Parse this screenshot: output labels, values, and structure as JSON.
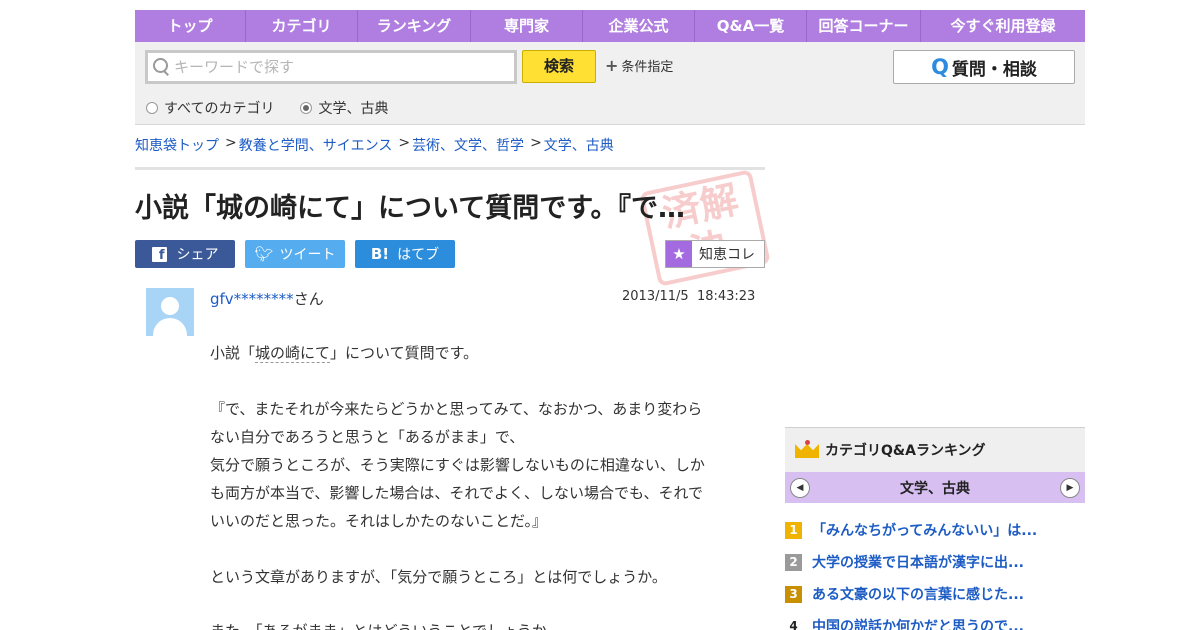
{
  "nav": {
    "items": [
      {
        "label": "トップ",
        "w": 111
      },
      {
        "label": "カテゴリ",
        "w": 112
      },
      {
        "label": "ランキング",
        "w": 113
      },
      {
        "label": "専門家",
        "w": 112
      },
      {
        "label": "企業公式",
        "w": 112
      },
      {
        "label": "Q&A一覧",
        "w": 112
      },
      {
        "label": "回答コーナー",
        "w": 114
      },
      {
        "label": "今すぐ利用登録",
        "w": 164
      }
    ]
  },
  "search": {
    "placeholder": "キーワードで探す",
    "button_label": "検索",
    "conditions_label": "条件指定",
    "ask_button_label": "質問・相談",
    "radio_all": "すべてのカテゴリ",
    "radio_current": "文学、古典"
  },
  "breadcrumb": {
    "items": [
      "知恵袋トップ",
      "教養と学問、サイエンス",
      "芸術、文学、哲学",
      "文学、古典"
    ],
    "separator": ">"
  },
  "question": {
    "title": "小説「城の崎にて」について質問です。『で…",
    "stamp": "済解決",
    "user_name": "gfv********",
    "user_suffix": "さん",
    "date": "2013/11/5",
    "time": "18:43:23",
    "line1_pre": "小説「",
    "line1_kw": "城の崎にて",
    "line1_post": "」について質問です。",
    "lines": [
      "『で、またそれが今来たらどうかと思ってみて、なおかつ、あまり変わら",
      "ない自分であろうと思うと「あるがまま」で、",
      "気分で願うところが、そう実際にすぐは影響しないものに相違ない、しか",
      "も両方が本当で、影響した場合は、それでよく、しない場合でも、それで",
      "いいのだと思った。それはしかたのないことだ。』",
      "という文章がありますが、「気分で願うところ」とは何でしょうか。",
      "また、「あるがまま」とはどういうことでしょうか。"
    ]
  },
  "share": {
    "facebook": "シェア",
    "twitter": "ツイート",
    "hatena": "はてブ",
    "hatena_icon": "B!",
    "chie_colle": "知恵コレ"
  },
  "ranking": {
    "title": "カテゴリQ&Aランキング",
    "category": "文学、古典",
    "items": [
      {
        "rank": "1",
        "text": "「みんなちがってみんないい」は...",
        "color": "#f0b400"
      },
      {
        "rank": "2",
        "text": "大学の授業で日本語が漢字に出...",
        "color": "#9a9a9a"
      },
      {
        "rank": "3",
        "text": "ある文豪の以下の言葉に感じた...",
        "color": "#c89000"
      },
      {
        "rank": "4",
        "text": "中国の説話か何かだと思うので...",
        "color": "#ffffff"
      }
    ]
  },
  "colors": {
    "nav": "#b07ee0",
    "link": "#1d5cc4",
    "search_button": "#ffe033"
  }
}
